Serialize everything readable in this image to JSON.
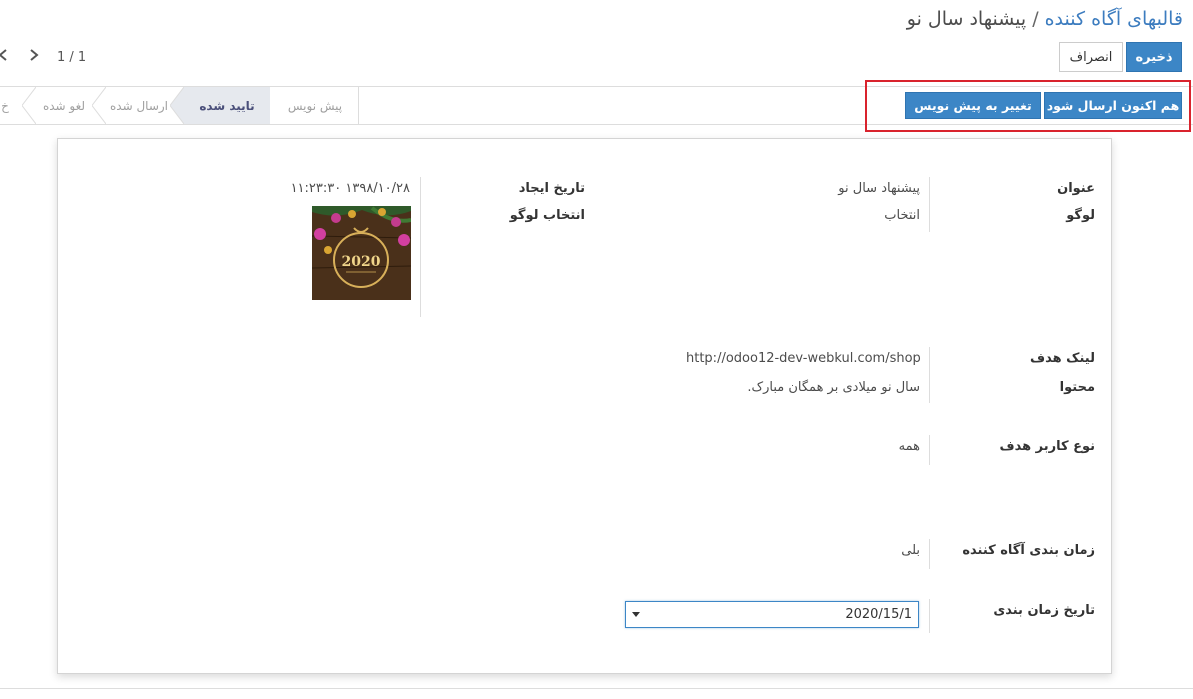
{
  "breadcrumb": {
    "parent": "قالبهای آگاه کننده",
    "separator": "/",
    "current": "پیشنهاد سال نو"
  },
  "buttons": {
    "save": "ذخیره",
    "discard": "انصراف"
  },
  "pager": {
    "value": "1 / 1"
  },
  "header_actions": {
    "send_now": "هم اکنون ارسال شود",
    "to_draft": "تغییر به پیش نویس"
  },
  "stages": [
    {
      "label": "پیش نویس",
      "active": false
    },
    {
      "label": "تایید شده",
      "active": true
    },
    {
      "label": "ارسال شده",
      "active": false
    },
    {
      "label": "لغو شده",
      "active": false
    },
    {
      "label": "خ",
      "active": false
    }
  ],
  "form": {
    "title_label": "عنوان",
    "title_value": "پیشنهاد سال نو",
    "logo_label": "لوگو",
    "logo_value": "انتخاب",
    "created_label": "تاریخ ایجاد",
    "created_value": "۱۳۹۸/۱۰/۲۸ ۱۱:۲۳:۳۰",
    "logo_select_label": "انتخاب لوگو",
    "logo_text": "2020",
    "target_link_label": "لینک هدف",
    "target_link_value": "http://odoo12-dev-webkul.com/shop",
    "content_label": "محتوا",
    "content_value": "سال نو میلادی بر همگان مبارک.",
    "target_user_type_label": "نوع کاربر هدف",
    "target_user_type_value": "همه",
    "scheduling_label": "زمان بندی آگاه کننده",
    "scheduling_value": "بلی",
    "schedule_date_label": "تاریخ زمان بندی",
    "schedule_date_value": "2020/15/1"
  },
  "colors": {
    "primary": "#3c86c6",
    "highlight_box": "#d9232d",
    "link": "#3c7cbf"
  }
}
